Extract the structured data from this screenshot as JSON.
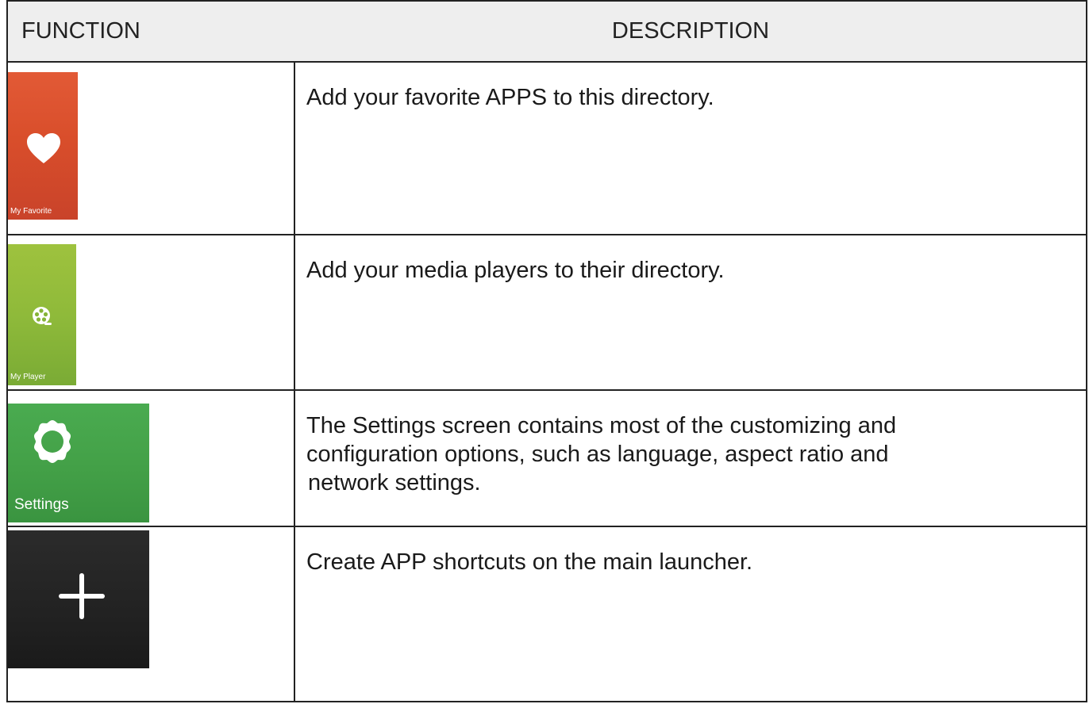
{
  "table": {
    "headers": {
      "function": "FUNCTION",
      "description": "DESCRIPTION"
    },
    "rows": [
      {
        "icon": "heart-icon",
        "tile_label": "My Favorite",
        "tile_color": "#d94e2b",
        "description_lines": [
          "Add your favorite APPS to this directory."
        ]
      },
      {
        "icon": "film-reel-icon",
        "tile_label": "My Player",
        "tile_color": "#8fba3a",
        "description_lines": [
          "Add your media players to their directory."
        ]
      },
      {
        "icon": "gear-icon",
        "tile_label": "Settings",
        "tile_color": "#43a047",
        "description_lines": [
          "The Settings screen contains most of the customizing and",
          "configuration options, such as language, aspect ratio and",
          "network settings."
        ]
      },
      {
        "icon": "plus-icon",
        "tile_label": "",
        "tile_color": "#222222",
        "description_lines": [
          "Create APP shortcuts on the main launcher."
        ]
      }
    ]
  }
}
